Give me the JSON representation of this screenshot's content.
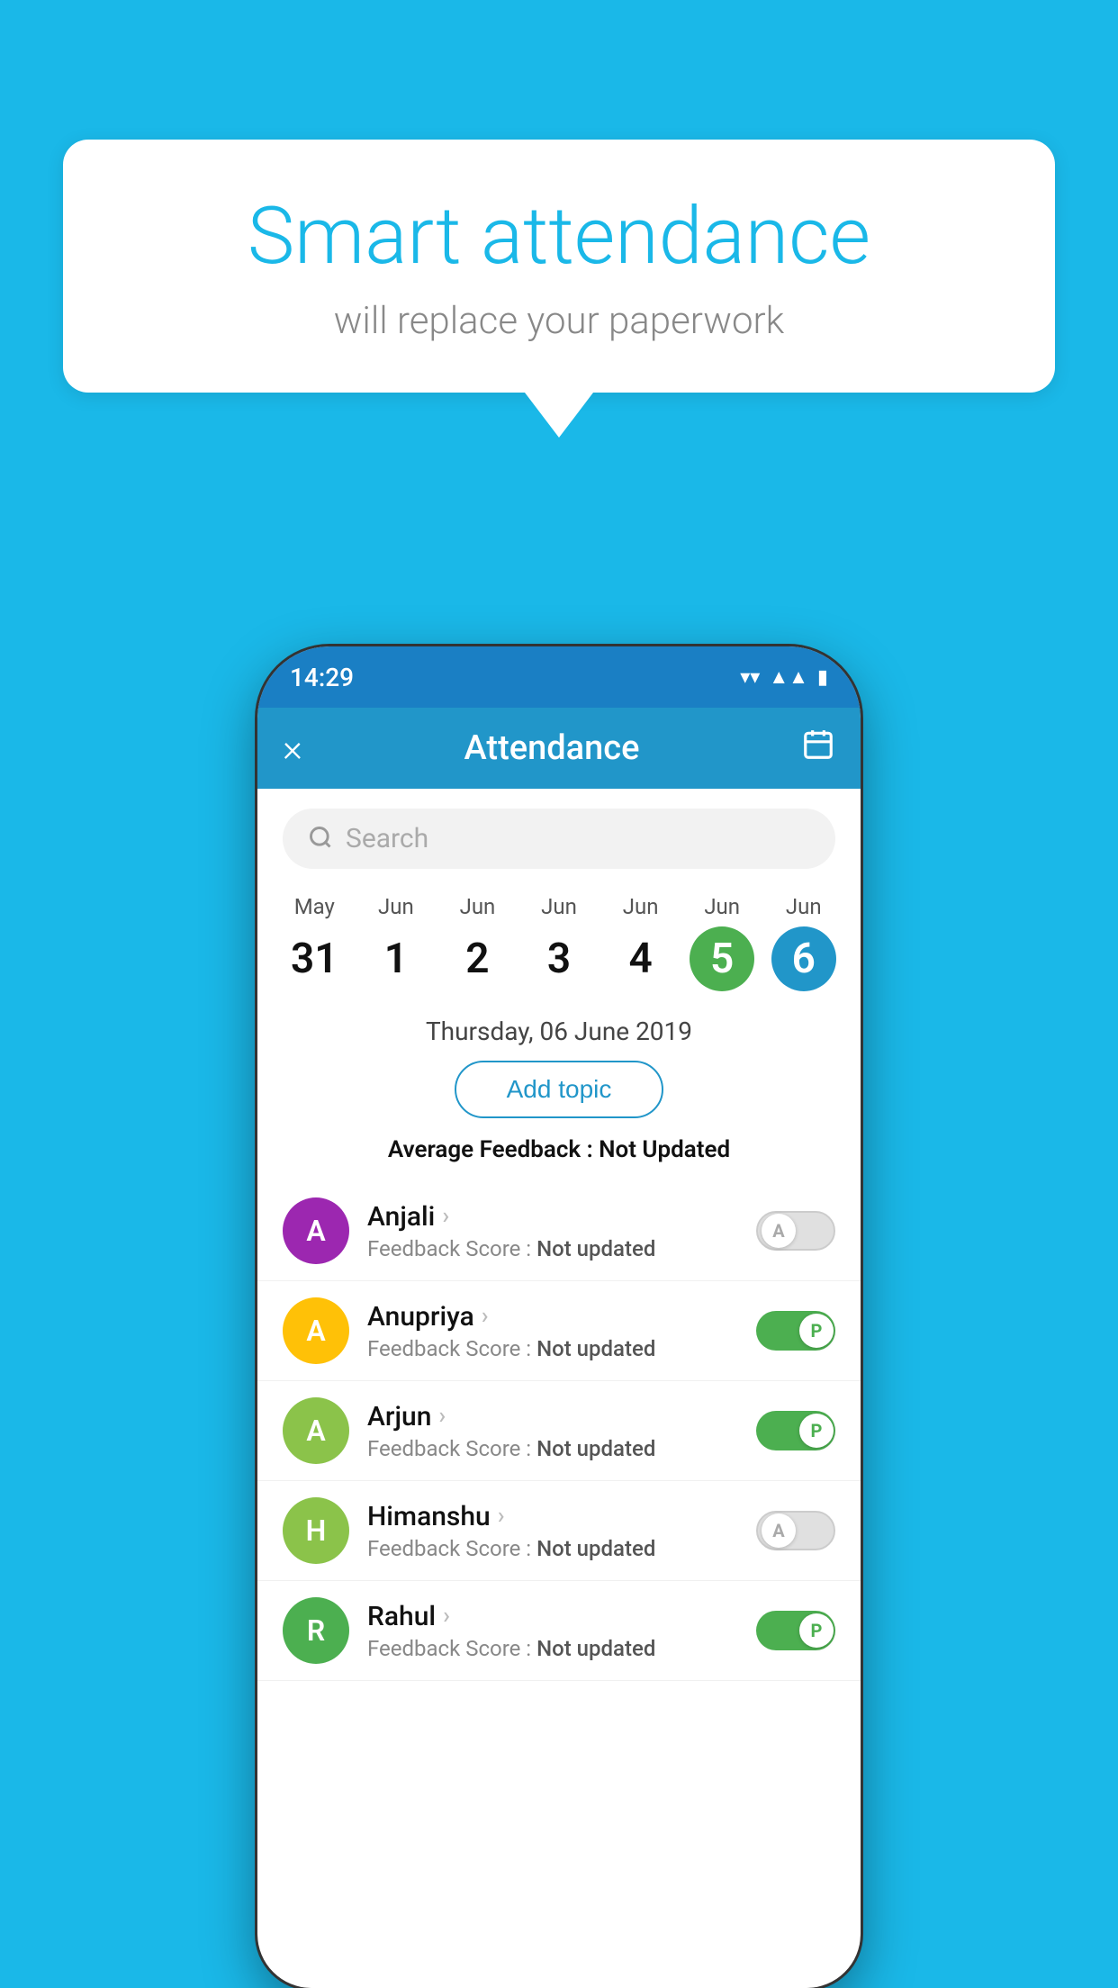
{
  "background_color": "#1ab8e8",
  "speech_bubble": {
    "title": "Smart attendance",
    "subtitle": "will replace your paperwork"
  },
  "phone": {
    "status_bar": {
      "time": "14:29"
    },
    "top_bar": {
      "title": "Attendance",
      "close_label": "×",
      "calendar_label": "📅"
    },
    "search": {
      "placeholder": "Search"
    },
    "calendar": {
      "days": [
        {
          "month": "May",
          "date": "31",
          "state": "normal"
        },
        {
          "month": "Jun",
          "date": "1",
          "state": "normal"
        },
        {
          "month": "Jun",
          "date": "2",
          "state": "normal"
        },
        {
          "month": "Jun",
          "date": "3",
          "state": "normal"
        },
        {
          "month": "Jun",
          "date": "4",
          "state": "normal"
        },
        {
          "month": "Jun",
          "date": "5",
          "state": "today"
        },
        {
          "month": "Jun",
          "date": "6",
          "state": "selected"
        }
      ]
    },
    "selected_date_label": "Thursday, 06 June 2019",
    "add_topic_label": "Add topic",
    "avg_feedback_label": "Average Feedback :",
    "avg_feedback_value": "Not Updated",
    "students": [
      {
        "name": "Anjali",
        "avatar_letter": "A",
        "avatar_color": "#9c27b0",
        "feedback_label": "Feedback Score :",
        "feedback_value": "Not updated",
        "toggle_state": "off",
        "toggle_letter": "A"
      },
      {
        "name": "Anupriya",
        "avatar_letter": "A",
        "avatar_color": "#ffc107",
        "feedback_label": "Feedback Score :",
        "feedback_value": "Not updated",
        "toggle_state": "on",
        "toggle_letter": "P"
      },
      {
        "name": "Arjun",
        "avatar_letter": "A",
        "avatar_color": "#8bc34a",
        "feedback_label": "Feedback Score :",
        "feedback_value": "Not updated",
        "toggle_state": "on",
        "toggle_letter": "P"
      },
      {
        "name": "Himanshu",
        "avatar_letter": "H",
        "avatar_color": "#8bc34a",
        "feedback_label": "Feedback Score :",
        "feedback_value": "Not updated",
        "toggle_state": "off",
        "toggle_letter": "A"
      },
      {
        "name": "Rahul",
        "avatar_letter": "R",
        "avatar_color": "#4caf50",
        "feedback_label": "Feedback Score :",
        "feedback_value": "Not updated",
        "toggle_state": "on",
        "toggle_letter": "P"
      }
    ]
  }
}
